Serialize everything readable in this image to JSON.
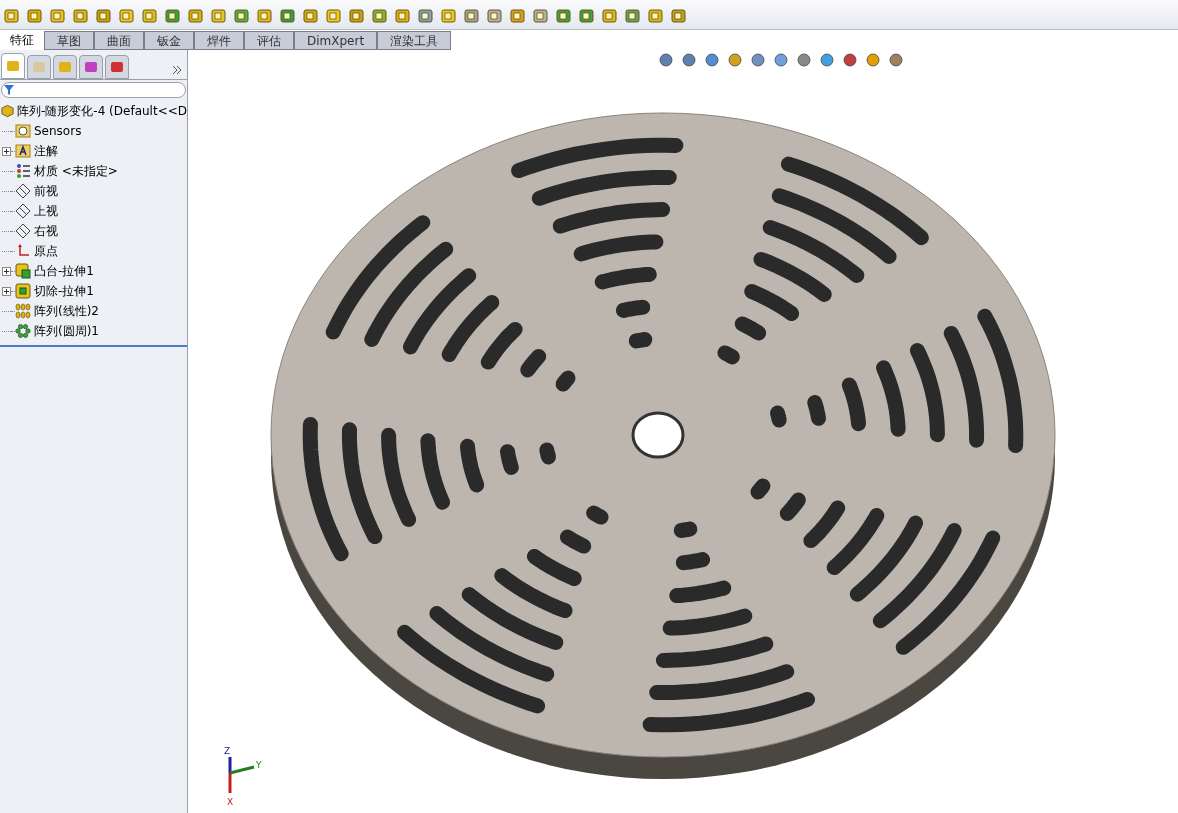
{
  "command_tabs": [
    {
      "label": "特征",
      "selected": true
    },
    {
      "label": "草图",
      "selected": false
    },
    {
      "label": "曲面",
      "selected": false
    },
    {
      "label": "钣金",
      "selected": false
    },
    {
      "label": "焊件",
      "selected": false
    },
    {
      "label": "评估",
      "selected": false
    },
    {
      "label": "DimXpert",
      "selected": false
    },
    {
      "label": "渲染工具",
      "selected": false
    }
  ],
  "panel_tabs": [
    {
      "selected": true
    },
    {
      "selected": false
    },
    {
      "selected": false
    },
    {
      "selected": false
    },
    {
      "selected": false
    }
  ],
  "feature_tree": {
    "root": "阵列-随形变化-4  (Default<<D",
    "items": [
      {
        "label": "Sensors",
        "kind": "sensor",
        "expandable": false
      },
      {
        "label": "注解",
        "kind": "annotation",
        "expandable": true
      },
      {
        "label": "材质 <未指定>",
        "kind": "material",
        "expandable": false
      },
      {
        "label": "前视",
        "kind": "plane",
        "expandable": false
      },
      {
        "label": "上视",
        "kind": "plane",
        "expandable": false
      },
      {
        "label": "右视",
        "kind": "plane",
        "expandable": false
      },
      {
        "label": "原点",
        "kind": "origin",
        "expandable": false
      },
      {
        "label": "凸台-拉伸1",
        "kind": "boss",
        "expandable": true
      },
      {
        "label": "切除-拉伸1",
        "kind": "cut",
        "expandable": true
      },
      {
        "label": "阵列(线性)2",
        "kind": "linear",
        "expandable": false
      },
      {
        "label": "阵列(圆周)1",
        "kind": "circular",
        "expandable": false
      }
    ]
  },
  "triad": {
    "z": "Z",
    "y": "Y",
    "x": "X"
  }
}
